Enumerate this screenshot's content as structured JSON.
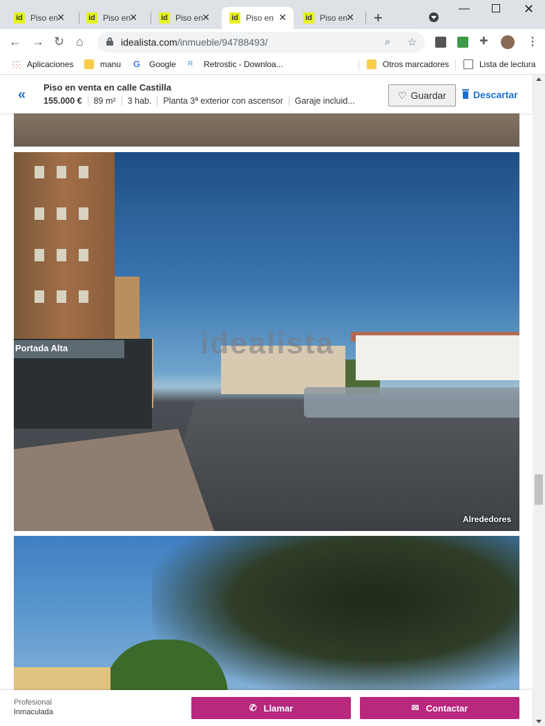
{
  "tabs": [
    {
      "favicon": "id",
      "title": "Piso en venta"
    },
    {
      "favicon": "id",
      "title": "Piso en venta"
    },
    {
      "favicon": "id",
      "title": "Piso en venta"
    },
    {
      "favicon": "id",
      "title": "Piso en venta",
      "active": true
    },
    {
      "favicon": "id",
      "title": "Piso en venta"
    }
  ],
  "toolbar": {
    "url_host": "idealista.com",
    "url_path": "/inmueble/94788493/"
  },
  "bookmarks": [
    {
      "label": "Aplicaciones",
      "icon": "apps-icon"
    },
    {
      "label": "manu",
      "icon": "folder-icon"
    },
    {
      "label": "Google",
      "icon": "google-icon"
    },
    {
      "label": "Retrostic - Downloa...",
      "icon": "retrostic-icon"
    }
  ],
  "bookmarks_right": [
    {
      "label": "Otros marcadores",
      "icon": "folder-icon"
    },
    {
      "label": "Lista de lectura",
      "icon": "reading-list-icon"
    }
  ],
  "listing": {
    "title": "Piso en venta en calle Castilla",
    "price": "155.000 €",
    "area": "89 m²",
    "rooms": "3 hab.",
    "floor": "Planta 3ª exterior con ascensor",
    "garage": "Garaje incluid...",
    "save_label": "Guardar",
    "discard_label": "Descartar"
  },
  "photos": {
    "watermark": "idealista",
    "sign_text": "Portada Alta",
    "caption_2": "Alrededores"
  },
  "bottom_bar": {
    "pro_type": "Profesional",
    "pro_name": "Inmaculada",
    "call_label": "Llamar",
    "contact_label": "Contactar"
  },
  "colors": {
    "accent_blue": "#1a6fd1",
    "cta_magenta": "#b8287f",
    "favicon_yellow": "#e5f21e"
  }
}
